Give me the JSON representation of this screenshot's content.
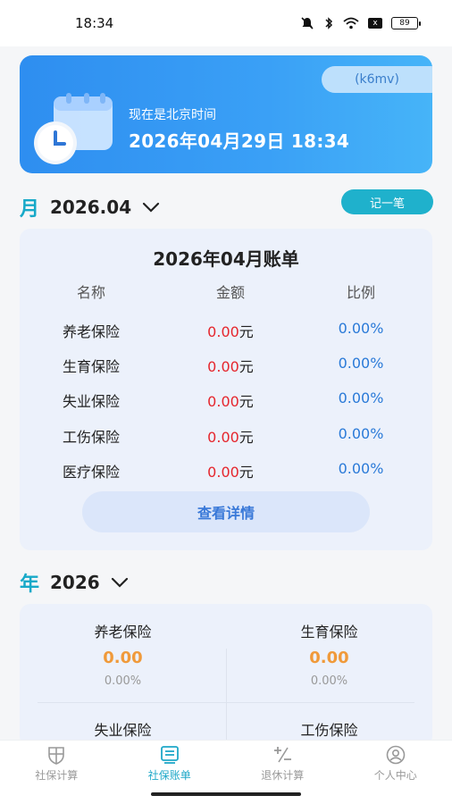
{
  "status_bar": {
    "time": "18:34",
    "battery": "89",
    "x_badge": "x"
  },
  "banner": {
    "tag": "(k6mv)",
    "subtitle": "现在是北京时间",
    "datetime": "2026年04月29日 18:34"
  },
  "month_section": {
    "char": "月",
    "value": "2026.04",
    "note_button": "记一笔"
  },
  "bill": {
    "title": "2026年04月账单",
    "headers": [
      "名称",
      "金额",
      "比例"
    ],
    "rows": [
      {
        "name": "养老保险",
        "amount": "0.00",
        "unit": "元",
        "percent": "0.00%"
      },
      {
        "name": "生育保险",
        "amount": "0.00",
        "unit": "元",
        "percent": "0.00%"
      },
      {
        "name": "失业保险",
        "amount": "0.00",
        "unit": "元",
        "percent": "0.00%"
      },
      {
        "name": "工伤保险",
        "amount": "0.00",
        "unit": "元",
        "percent": "0.00%"
      },
      {
        "name": "医疗保险",
        "amount": "0.00",
        "unit": "元",
        "percent": "0.00%"
      }
    ],
    "detail_button": "查看详情"
  },
  "year_section": {
    "char": "年",
    "value": "2026",
    "items": [
      {
        "name": "养老保险",
        "amount": "0.00",
        "percent": "0.00%"
      },
      {
        "name": "生育保险",
        "amount": "0.00",
        "percent": "0.00%"
      },
      {
        "name": "失业保险"
      },
      {
        "name": "工伤保险"
      }
    ]
  },
  "tabs": [
    {
      "label": "社保计算",
      "icon": "shield-icon",
      "active": false
    },
    {
      "label": "社保账单",
      "icon": "bill-icon",
      "active": true
    },
    {
      "label": "退休计算",
      "icon": "plus-minus-icon",
      "active": false
    },
    {
      "label": "个人中心",
      "icon": "user-icon",
      "active": false
    }
  ],
  "colors": {
    "accent": "#1fb1cc",
    "amount_red": "#e5262d",
    "percent_blue": "#2a7ad8",
    "year_orange": "#f09a3a"
  }
}
